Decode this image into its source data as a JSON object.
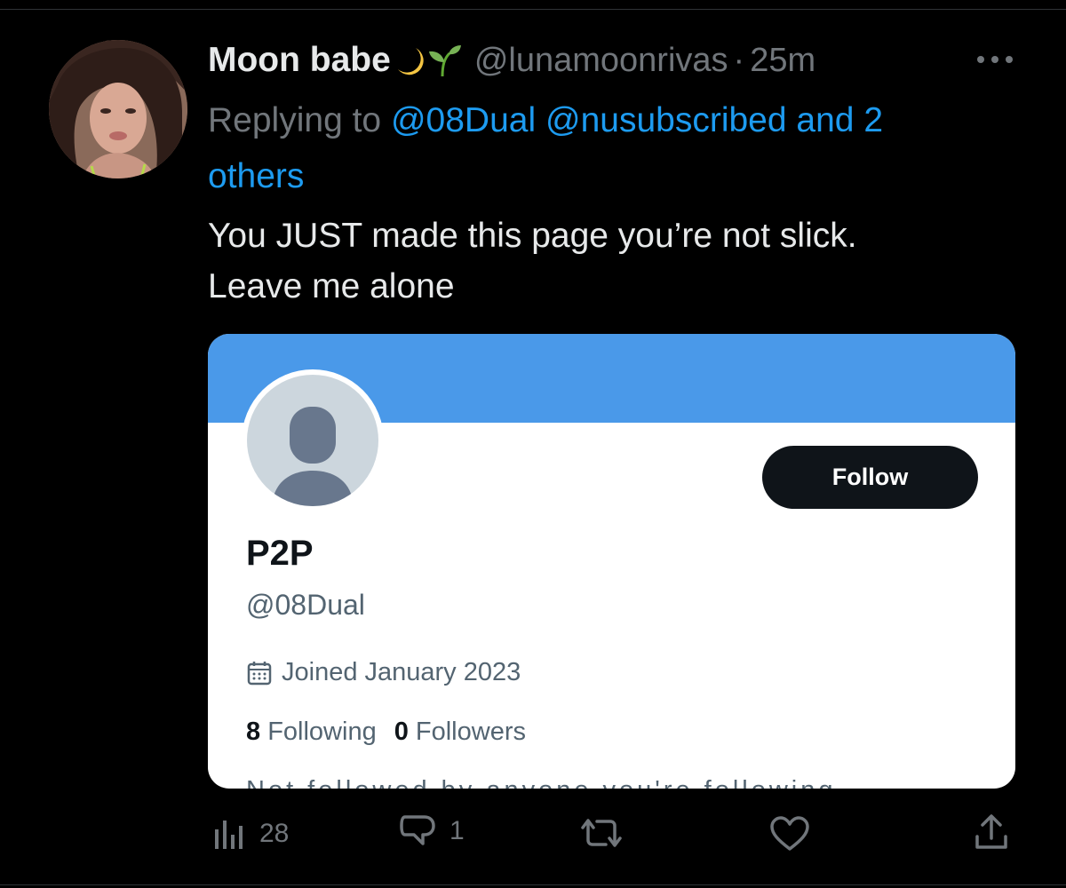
{
  "tweet": {
    "author": {
      "display_name": "Moon babe",
      "emoji": [
        "crescent-moon",
        "seedling"
      ],
      "handle": "@lunamoonrivas",
      "separator": "·",
      "time": "25m"
    },
    "replying": {
      "prefix": "Replying to ",
      "mention_1": "@08Dual",
      "mention_2": "@nusubscribed",
      "connector": " and ",
      "others_line_1": "2",
      "others_line_2": "others"
    },
    "text": {
      "line_1": "You JUST made this page you’re not slick.",
      "line_2": "Leave me alone"
    }
  },
  "profile_card": {
    "name": "P2P",
    "handle": "@08Dual",
    "joined": "Joined January 2023",
    "following_count": "8",
    "following_label": " Following",
    "followers_count": "0",
    "followers_label": " Followers",
    "follow_label": "Follow",
    "cutoff_text": "Not followed by anyone you're following"
  },
  "actions": {
    "views": "28",
    "replies": "1",
    "retweets": "",
    "likes": ""
  },
  "colors": {
    "background": "#000000",
    "text": "#e7e9ea",
    "muted": "#71767b",
    "accent": "#1d9bf0",
    "banner": "#4a99e9",
    "follow_button": "#0f1419"
  }
}
